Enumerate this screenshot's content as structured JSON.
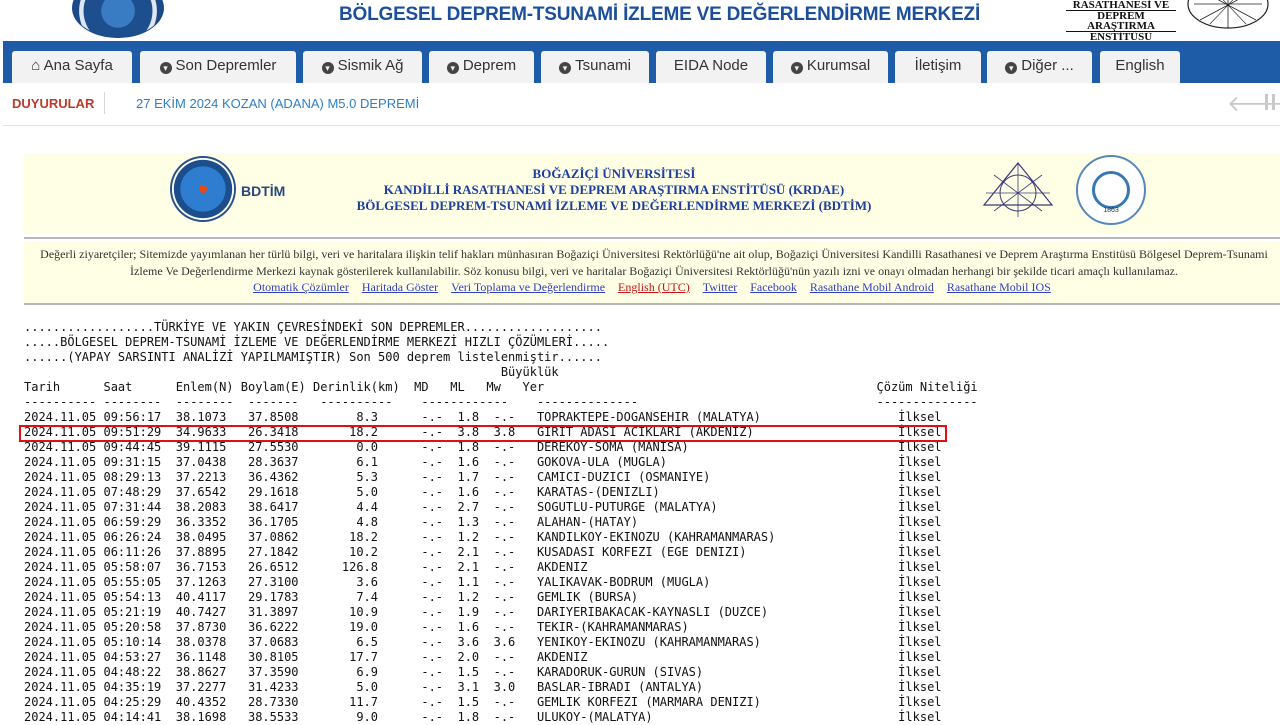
{
  "header": {
    "site_title": "BÖLGESEL DEPREM-TSUNAMİ İZLEME VE DEĞERLENDİRME MERKEZİ",
    "rasathane_line1": "RASATHANESİ VE",
    "rasathane_line2": "DEPREM ARAŞTIRMA",
    "rasathane_line3": "ENSTİTÜSÜ"
  },
  "nav": [
    {
      "label": "Ana Sayfa",
      "icon": "home-icon"
    },
    {
      "label": "Son Depremler",
      "icon": "dropdown-icon"
    },
    {
      "label": "Sismik Ağ",
      "icon": "dropdown-icon"
    },
    {
      "label": "Deprem",
      "icon": "dropdown-icon"
    },
    {
      "label": "Tsunami",
      "icon": "dropdown-icon"
    },
    {
      "label": "EIDA Node",
      "icon": ""
    },
    {
      "label": "Kurumsal",
      "icon": "dropdown-icon"
    },
    {
      "label": "İletişim",
      "icon": ""
    },
    {
      "label": "Diğer ...",
      "icon": "dropdown-icon"
    },
    {
      "label": "English",
      "icon": ""
    }
  ],
  "announcements": {
    "label": "DUYURULAR",
    "text": "27 EKİM 2024 KOZAN (ADANA) M5.0 DEPREMİ"
  },
  "institution": {
    "bdtim": "BDTİM",
    "line1": "BOĞAZİÇİ ÜNİVERSİTESİ",
    "line2": "KANDİLLİ RASATHANESİ VE DEPREM ARAŞTIRMA ENSTİTÜSÜ (KRDAE)",
    "line3": "BÖLGESEL DEPREM-TSUNAMİ İZLEME VE DEĞERLENDİRME MERKEZİ (BDTİM)",
    "seal_year": "1863"
  },
  "notice": {
    "text": "Değerli ziyaretçiler; Sitemizde yayımlanan her türlü bilgi, veri ve haritalara ilişkin telif hakları münhasıran Boğaziçi Üniversitesi Rektörlüğü'ne ait olup, Boğaziçi Üniversitesi Kandilli Rasathanesi ve Deprem Araştırma Enstitüsü Bölgesel Deprem-Tsunami İzleme Ve Değerlendirme Merkezi kaynak gösterilerek kullanılabilir. Söz konusu bilgi, veri ve haritalar Boğaziçi Üniversitesi Rektörlüğü'nün yazılı izni ve onayı olmadan herhangi bir şekilde ticari amaçlı kullanılamaz.",
    "links": [
      "Otomatik Çözümler",
      "Haritada Göster",
      "Veri Toplama ve Değerlendirme",
      "English (UTC)",
      "Twitter",
      "Facebook",
      "Rasathane Mobil Android",
      "Rasathane Mobil IOS"
    ]
  },
  "list": {
    "intro_lines": [
      "..................TÜRKİYE VE YAKIN ÇEVRESİNDEKİ SON DEPREMLER...................",
      ".....BÖLGESEL DEPREM-TSUNAMİ İZLEME VE DEĞERLENDİRME MERKEZİ HIZLI ÇÖZÜMLERİ.....",
      "......(YAPAY SARSINTI ANALİZİ YAPILMAMIŞTIR) Son 500 deprem listelenmiştir......"
    ],
    "header_magnitude": "Büyüklük",
    "columns": [
      "Tarih",
      "Saat",
      "Enlem(N)",
      "Boylam(E)",
      "Derinlik(km)",
      "MD",
      "ML",
      "Mw",
      "Yer",
      "Çözüm Niteliği"
    ],
    "highlighted_index": 1,
    "rows": [
      [
        "2024.11.05",
        "09:56:17",
        "38.1073",
        "37.8508",
        "8.3",
        "-.-",
        "1.8",
        "-.-",
        "TOPRAKTEPE-DOGANSEHIR (MALATYA)",
        "İlksel"
      ],
      [
        "2024.11.05",
        "09:51:29",
        "34.9633",
        "26.3418",
        "18.2",
        "-.-",
        "3.8",
        "3.8",
        "GIRIT ADASI ACIKLARI (AKDENIZ)",
        "İlksel"
      ],
      [
        "2024.11.05",
        "09:44:45",
        "39.1115",
        "27.5530",
        "0.0",
        "-.-",
        "1.8",
        "-.-",
        "DEREKOY-SOMA (MANISA)",
        "İlksel"
      ],
      [
        "2024.11.05",
        "09:31:15",
        "37.0438",
        "28.3637",
        "6.1",
        "-.-",
        "1.6",
        "-.-",
        "GOKOVA-ULA (MUGLA)",
        "İlksel"
      ],
      [
        "2024.11.05",
        "08:29:13",
        "37.2213",
        "36.4362",
        "5.3",
        "-.-",
        "1.7",
        "-.-",
        "CAMICI-DUZICI (OSMANIYE)",
        "İlksel"
      ],
      [
        "2024.11.05",
        "07:48:29",
        "37.6542",
        "29.1618",
        "5.0",
        "-.-",
        "1.6",
        "-.-",
        "KARATAS-(DENIZLI)",
        "İlksel"
      ],
      [
        "2024.11.05",
        "07:31:44",
        "38.2083",
        "38.6417",
        "4.4",
        "-.-",
        "2.7",
        "-.-",
        "SOGUTLU-PUTURGE (MALATYA)",
        "İlksel"
      ],
      [
        "2024.11.05",
        "06:59:29",
        "36.3352",
        "36.1705",
        "4.8",
        "-.-",
        "1.3",
        "-.-",
        "ALAHAN-(HATAY)",
        "İlksel"
      ],
      [
        "2024.11.05",
        "06:26:24",
        "38.0495",
        "37.0862",
        "18.2",
        "-.-",
        "1.2",
        "-.-",
        "KANDILKOY-EKINOZU (KAHRAMANMARAS)",
        "İlksel"
      ],
      [
        "2024.11.05",
        "06:11:26",
        "37.8895",
        "27.1842",
        "10.2",
        "-.-",
        "2.1",
        "-.-",
        "KUSADASI KORFEZI (EGE DENIZI)",
        "İlksel"
      ],
      [
        "2024.11.05",
        "05:58:07",
        "36.7153",
        "26.6512",
        "126.8",
        "-.-",
        "2.1",
        "-.-",
        "AKDENIZ",
        "İlksel"
      ],
      [
        "2024.11.05",
        "05:55:05",
        "37.1263",
        "27.3100",
        "3.6",
        "-.-",
        "1.1",
        "-.-",
        "YALIKAVAK-BODRUM (MUGLA)",
        "İlksel"
      ],
      [
        "2024.11.05",
        "05:54:13",
        "40.4117",
        "29.1783",
        "7.4",
        "-.-",
        "1.2",
        "-.-",
        "GEMLIK (BURSA)",
        "İlksel"
      ],
      [
        "2024.11.05",
        "05:21:19",
        "40.7427",
        "31.3897",
        "10.9",
        "-.-",
        "1.9",
        "-.-",
        "DARIYERIBAKACAK-KAYNASLI (DUZCE)",
        "İlksel"
      ],
      [
        "2024.11.05",
        "05:20:58",
        "37.8730",
        "36.6222",
        "19.0",
        "-.-",
        "1.6",
        "-.-",
        "TEKIR-(KAHRAMANMARAS)",
        "İlksel"
      ],
      [
        "2024.11.05",
        "05:10:14",
        "38.0378",
        "37.0683",
        "6.5",
        "-.-",
        "3.6",
        "3.6",
        "YENIKOY-EKINOZU (KAHRAMANMARAS)",
        "İlksel"
      ],
      [
        "2024.11.05",
        "04:53:27",
        "36.1148",
        "30.8105",
        "17.7",
        "-.-",
        "2.0",
        "-.-",
        "AKDENIZ",
        "İlksel"
      ],
      [
        "2024.11.05",
        "04:48:22",
        "38.8627",
        "37.3590",
        "6.9",
        "-.-",
        "1.5",
        "-.-",
        "KARADORUK-GURUN (SIVAS)",
        "İlksel"
      ],
      [
        "2024.11.05",
        "04:35:19",
        "37.2277",
        "31.4233",
        "5.0",
        "-.-",
        "3.1",
        "3.0",
        "BASLAR-IBRADI (ANTALYA)",
        "İlksel"
      ],
      [
        "2024.11.05",
        "04:25:29",
        "40.4352",
        "28.7330",
        "11.7",
        "-.-",
        "1.5",
        "-.-",
        "GEMLIK KORFEZI (MARMARA DENIZI)",
        "İlksel"
      ],
      [
        "2024.11.05",
        "04:14:41",
        "38.1698",
        "38.5533",
        "9.0",
        "-.-",
        "1.8",
        "-.-",
        "ULUKOY-(MALATYA)",
        "İlksel"
      ]
    ]
  }
}
